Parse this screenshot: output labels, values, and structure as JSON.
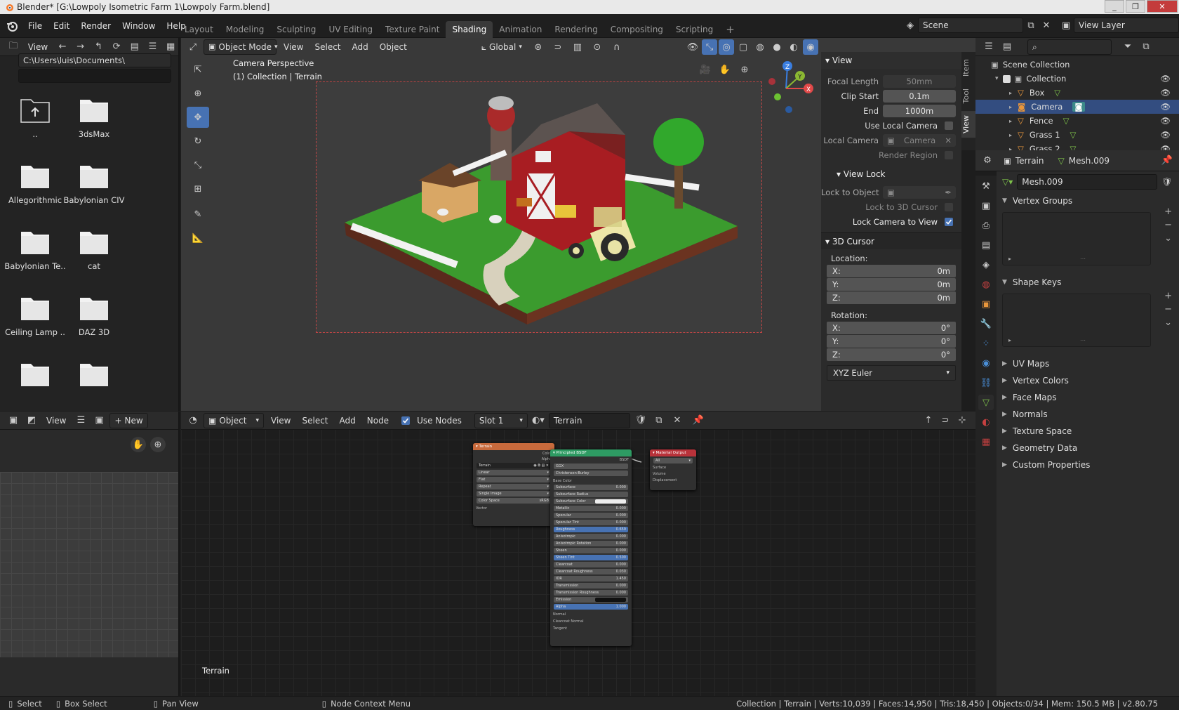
{
  "window": {
    "title": "Blender* [G:\\Lowpoly Isometric Farm 1\\Lowpoly Farm.blend]"
  },
  "menu": {
    "file": "File",
    "edit": "Edit",
    "render": "Render",
    "window": "Window",
    "help": "Help"
  },
  "workspaces": [
    "Layout",
    "Modeling",
    "Sculpting",
    "UV Editing",
    "Texture Paint",
    "Shading",
    "Animation",
    "Rendering",
    "Compositing",
    "Scripting"
  ],
  "workspace_add": "+",
  "scene": {
    "name": "Scene",
    "view_layer": "View Layer"
  },
  "filebrowser": {
    "view_label": "View",
    "path": "C:\\Users\\luis\\Documents\\",
    "items": [
      "..",
      "3dsMax",
      "Allegorithmic",
      "Babylonian CIV",
      "Babylonian Te..",
      "cat",
      "Ceiling Lamp ..",
      "DAZ 3D",
      "",
      ""
    ]
  },
  "viewport": {
    "mode": "Object Mode",
    "menu": [
      "View",
      "Select",
      "Add",
      "Object"
    ],
    "orientation": "Global",
    "camera_label": "Camera Perspective",
    "collection_label": "(1) Collection | Terrain"
  },
  "npanel": {
    "tabs": [
      "Item",
      "Tool",
      "View"
    ],
    "view_title": "View",
    "focal_length_label": "Focal Length",
    "focal_length": "50mm",
    "clip_start_label": "Clip Start",
    "clip_start": "0.1m",
    "clip_end_label": "End",
    "clip_end": "1000m",
    "use_local_camera": "Use Local Camera",
    "local_camera_label": "Local Camera",
    "local_camera": "Camera",
    "render_region": "Render Region",
    "view_lock_title": "View Lock",
    "lock_to_object": "Lock to Object",
    "lock_to_cursor": "Lock to 3D Cursor",
    "lock_camera": "Lock Camera to View",
    "cursor_title": "3D Cursor",
    "location_label": "Location:",
    "loc": [
      {
        "axis": "X:",
        "val": "0m"
      },
      {
        "axis": "Y:",
        "val": "0m"
      },
      {
        "axis": "Z:",
        "val": "0m"
      }
    ],
    "rotation_label": "Rotation:",
    "rot": [
      {
        "axis": "X:",
        "val": "0°"
      },
      {
        "axis": "Y:",
        "val": "0°"
      },
      {
        "axis": "Z:",
        "val": "0°"
      }
    ],
    "rotation_mode": "XYZ Euler"
  },
  "outliner": {
    "root": "Scene Collection",
    "collection": "Collection",
    "items": [
      "Box",
      "Camera",
      "Fence",
      "Grass 1",
      "Grass 2"
    ]
  },
  "properties": {
    "object": "Terrain",
    "mesh": "Mesh.009",
    "mesh_field": "Mesh.009",
    "vertex_groups": "Vertex Groups",
    "shape_keys": "Shape Keys",
    "sections": [
      "UV Maps",
      "Vertex Colors",
      "Face Maps",
      "Normals",
      "Texture Space",
      "Geometry Data",
      "Custom Properties"
    ]
  },
  "image_editor": {
    "view_label": "View",
    "new_label": "New"
  },
  "node_editor": {
    "object_label": "Object",
    "menu": [
      "View",
      "Select",
      "Add",
      "Node"
    ],
    "use_nodes": "Use Nodes",
    "slot": "Slot 1",
    "material": "Terrain",
    "footer_label": "Terrain",
    "tex_node": {
      "title": "Terrain",
      "out_color": "Color",
      "out_alpha": "Alpha",
      "image": "Terrain",
      "fields": [
        "Linear",
        "Flat",
        "Repeat",
        "Single Image"
      ],
      "cs_label": "Color Space",
      "cs_value": "sRGB",
      "vector": "Vector"
    },
    "bsdf_node": {
      "title": "Principled BSDF",
      "out": "BSDF",
      "fields": [
        {
          "l": "GGX",
          "v": ""
        },
        {
          "l": "Christensen-Burley",
          "v": ""
        },
        {
          "l": "Base Color",
          "v": "",
          "plain": true
        },
        {
          "l": "Subsurface",
          "v": "0.000"
        },
        {
          "l": "Subsurface Radius",
          "v": ""
        },
        {
          "l": "Subsurface Color",
          "v": ""
        },
        {
          "l": "Metallic",
          "v": "0.000"
        },
        {
          "l": "Specular",
          "v": "0.000"
        },
        {
          "l": "Specular Tint",
          "v": "0.000"
        },
        {
          "l": "Roughness",
          "v": "0.659",
          "blue": true
        },
        {
          "l": "Anisotropic",
          "v": "0.000"
        },
        {
          "l": "Anisotropic Rotation",
          "v": "0.000"
        },
        {
          "l": "Sheen",
          "v": "0.000"
        },
        {
          "l": "Sheen Tint",
          "v": "0.500",
          "blue": true
        },
        {
          "l": "Clearcoat",
          "v": "0.000"
        },
        {
          "l": "Clearcoat Roughness",
          "v": "0.030"
        },
        {
          "l": "IOR",
          "v": "1.450"
        },
        {
          "l": "Transmission",
          "v": "0.000"
        },
        {
          "l": "Transmission Roughness",
          "v": "0.000"
        },
        {
          "l": "Emission",
          "v": ""
        },
        {
          "l": "Alpha",
          "v": "1.000",
          "blue": true
        },
        {
          "l": "Normal",
          "v": "",
          "plain": true
        },
        {
          "l": "Clearcoat Normal",
          "v": "",
          "plain": true
        },
        {
          "l": "Tangent",
          "v": "",
          "plain": true
        }
      ]
    },
    "out_node": {
      "title": "Material Output",
      "target": "All",
      "inputs": [
        "Surface",
        "Volume",
        "Displacement"
      ]
    }
  },
  "status": {
    "select": "Select",
    "box_select": "Box Select",
    "pan_view": "Pan View",
    "node_context": "Node Context Menu",
    "stats": "Collection | Terrain | Verts:10,039 | Faces:14,950 | Tris:18,450 | Objects:0/34 | Mem: 150.5 MB | v2.80.75"
  },
  "colors": {
    "accent": "#4772b3",
    "tex_header": "#c86a3c",
    "bsdf_header": "#2e9b63",
    "output_header": "#b9323a"
  }
}
